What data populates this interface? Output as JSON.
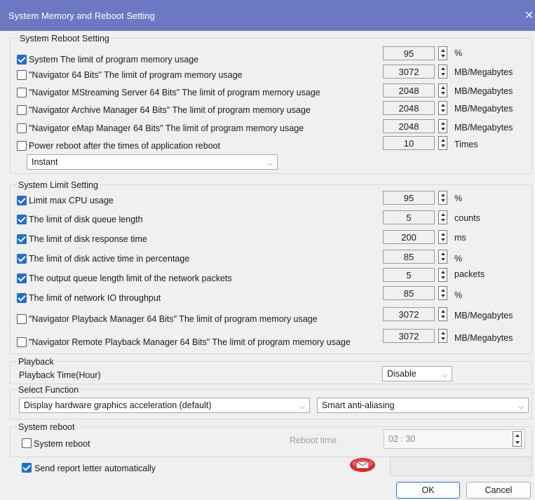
{
  "window": {
    "title": "System Memory and Reboot Setting",
    "close_glyph": "✕"
  },
  "reboot_group": {
    "title": "System Reboot Setting",
    "rows": [
      {
        "checked": true,
        "label": "System The limit of program memory usage",
        "value": "95",
        "unit": "%"
      },
      {
        "checked": false,
        "label": "\"Navigator 64 Bits\" The limit of program memory usage",
        "value": "3072",
        "unit": "MB/Megabytes"
      },
      {
        "checked": false,
        "label": "\"Navigator MStreaming Server 64 Bits\" The limit of program memory usage",
        "value": "2048",
        "unit": "MB/Megabytes"
      },
      {
        "checked": false,
        "label": "\"Navigator Archive Manager 64 Bits\" The limit of program memory usage",
        "value": "2048",
        "unit": "MB/Megabytes"
      },
      {
        "checked": false,
        "label": "\"Navigator eMap Manager 64 Bits\" The limit of program memory usage",
        "value": "2048",
        "unit": "MB/Megabytes"
      },
      {
        "checked": false,
        "label": "Power reboot after the times of application reboot",
        "value": "10",
        "unit": "Times"
      }
    ],
    "mode_select": "Instant"
  },
  "limit_group": {
    "title": "System Limit Setting",
    "rows": [
      {
        "checked": true,
        "label": "Limit max CPU usage",
        "value": "95",
        "unit": "%"
      },
      {
        "checked": true,
        "label": "The limit of disk queue length",
        "value": "5",
        "unit": "counts"
      },
      {
        "checked": true,
        "label": "The limit of disk response time",
        "value": "200",
        "unit": "ms"
      },
      {
        "checked": true,
        "label": "The limit of disk active time in percentage",
        "value": "85",
        "unit": "%"
      },
      {
        "checked": true,
        "label": "The output queue length limit of the network packets",
        "value": "5",
        "unit": "packets"
      },
      {
        "checked": true,
        "label": "The limit of network IO throughput",
        "value": "85",
        "unit": "%"
      },
      {
        "checked": false,
        "label": "\"Navigator Playback Manager 64 Bits\" The limit of program memory usage",
        "value": "3072",
        "unit": "MB/Megabytes"
      },
      {
        "checked": false,
        "label": "\"Navigator Remote Playback Manager 64 Bits\" The limit of program memory usage",
        "value": "3072",
        "unit": "MB/Megabytes"
      }
    ]
  },
  "playback_group": {
    "title": "Playback",
    "label": "Playback Time(Hour)",
    "select": "Disable"
  },
  "function_group": {
    "title": "Select Function",
    "graphics_select": "Display hardware graphics acceleration (default)",
    "aliasing_select": "Smart anti-aliasing"
  },
  "sysreboot_group": {
    "title": "System reboot",
    "checkbox_label": "System reboot",
    "checked": false,
    "time_label": "Reboot time",
    "time_value": "02 : 30"
  },
  "report": {
    "checked": true,
    "label": "Send report letter automatically",
    "icon": "mail-icon"
  },
  "buttons": {
    "ok": "OK",
    "cancel": "Cancel"
  },
  "colors": {
    "titlebar": "#6c79c2",
    "check": "#1f6fd0",
    "ok_border": "#2d6ad8",
    "mail_icon": "#d92a2a"
  }
}
